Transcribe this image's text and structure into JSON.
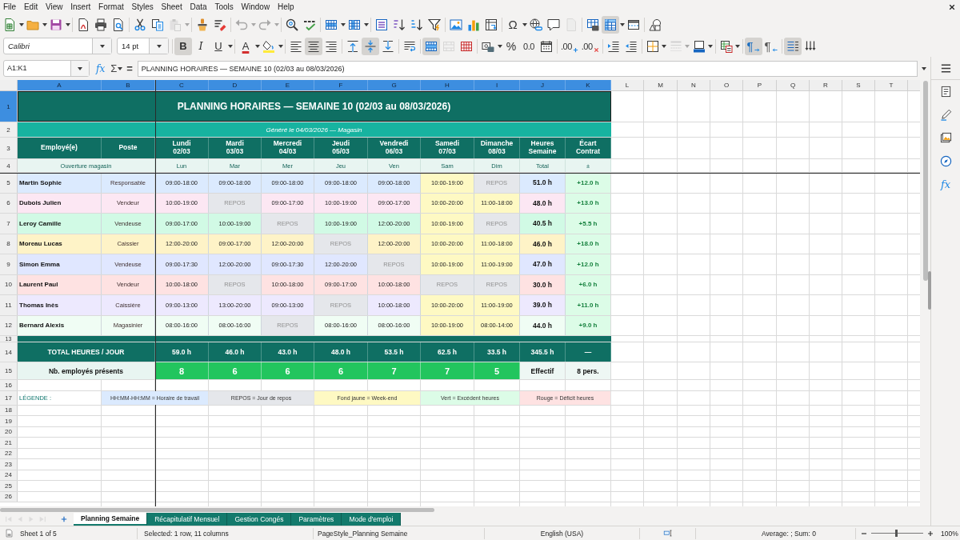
{
  "menu_bar": {
    "items": [
      "File",
      "Edit",
      "View",
      "Insert",
      "Format",
      "Styles",
      "Sheet",
      "Data",
      "Tools",
      "Window",
      "Help"
    ]
  },
  "standard_toolbar": {
    "paste": {
      "disabled": true
    },
    "undo": {
      "disabled": true
    },
    "redo": {
      "disabled": true
    },
    "special_character": {
      "label": "Ω"
    },
    "headers_footers": {
      "disabled": true
    },
    "freeze_panes": {
      "selected": true
    }
  },
  "formatting_toolbar": {
    "font_name": "Calibri",
    "font_size": "14 pt",
    "bold": {
      "label": "B",
      "selected": true
    },
    "italic": {
      "label": "I",
      "selected": false
    },
    "underline": {
      "label": "U",
      "selected": false
    },
    "font_color": {
      "label": "A"
    },
    "align_left": {
      "selected": false
    },
    "align_center": {
      "selected": true
    },
    "align_right": {
      "selected": false
    },
    "align_top": {
      "selected": false
    },
    "align_middle": {
      "selected": true
    },
    "align_bottom": {
      "selected": false
    },
    "wrap_text": {
      "selected": false
    },
    "merge_center": {
      "selected": true
    },
    "merge_cells": {
      "disabled": true
    },
    "percent": {
      "label": "%"
    },
    "number": {
      "label": "0.0"
    },
    "add_decimal": {
      "label": ".00"
    },
    "delete_decimal": {
      "label": ".00"
    },
    "border_style": {
      "disabled": true
    },
    "paragraph_ltr": {
      "label": "¶",
      "selected": true
    },
    "paragraph_rtl": {
      "label": "¶",
      "selected": false
    },
    "text_left_to_right": {
      "selected": true
    },
    "text_vertical": {
      "selected": false
    }
  },
  "formula_bar": {
    "name_box": "A1:K1",
    "function_wizard": "fx",
    "sum": "Σ",
    "formula": "=",
    "content": "PLANNING HORAIRES — SEMAINE 10 (02/03 au 08/03/2026)"
  },
  "sidebar": {
    "functions": "fx"
  },
  "sheet": {
    "columns": [
      {
        "label": "A",
        "selected": true
      },
      {
        "label": "B",
        "selected": true
      },
      {
        "label": "C",
        "selected": true
      },
      {
        "label": "D",
        "selected": true
      },
      {
        "label": "E",
        "selected": true
      },
      {
        "label": "F",
        "selected": true
      },
      {
        "label": "G",
        "selected": true
      },
      {
        "label": "H",
        "selected": true
      },
      {
        "label": "I",
        "selected": true
      },
      {
        "label": "J",
        "selected": true
      },
      {
        "label": "K",
        "selected": true
      },
      {
        "label": "L",
        "selected": false
      },
      {
        "label": "M",
        "selected": false
      },
      {
        "label": "N",
        "selected": false
      },
      {
        "label": "O",
        "selected": false
      },
      {
        "label": "P",
        "selected": false
      },
      {
        "label": "Q",
        "selected": false
      },
      {
        "label": "R",
        "selected": false
      },
      {
        "label": "S",
        "selected": false
      },
      {
        "label": "T",
        "selected": false
      }
    ],
    "rows": [
      {
        "number": "1",
        "selected": true,
        "kind": "title",
        "text": "PLANNING HORAIRES — SEMAINE 10 (02/03 au 08/03/2026)"
      },
      {
        "number": "2",
        "selected": false,
        "kind": "subtitle",
        "text": "Généré le 04/03/2026 — Magasin"
      },
      {
        "number": "3",
        "selected": false,
        "kind": "header",
        "cells": [
          "Employé(e)",
          "Poste",
          "Lundi\n02/03",
          "Mardi\n03/03",
          "Mercredi\n04/03",
          "Jeudi\n05/03",
          "Vendredi\n06/03",
          "Samedi\n07/03",
          "Dimanche\n08/03",
          "Heures\nSemaine",
          "Écart\nContrat"
        ]
      },
      {
        "number": "4",
        "selected": false,
        "kind": "subheader",
        "label": "Ouverture magasin",
        "cells": [
          "Lun",
          "Mar",
          "Mer",
          "Jeu",
          "Ven",
          "Sam",
          "Dim",
          "Total",
          "±"
        ]
      },
      {
        "number": "5",
        "selected": false,
        "kind": "employee",
        "color": "#dbeafe",
        "name": "Martin Sophie",
        "role": "Responsable",
        "shifts": [
          {
            "text": "09:00-18:00",
            "kind": "work"
          },
          {
            "text": "09:00-18:00",
            "kind": "work"
          },
          {
            "text": "09:00-18:00",
            "kind": "work"
          },
          {
            "text": "09:00-18:00",
            "kind": "work"
          },
          {
            "text": "09:00-18:00",
            "kind": "work"
          },
          {
            "text": "10:00-19:00",
            "kind": "weekend"
          },
          {
            "text": "REPOS",
            "kind": "rest"
          }
        ],
        "hours": "51.0 h",
        "balance": {
          "text": "+12.0 h",
          "kind": "excess"
        }
      },
      {
        "number": "6",
        "selected": false,
        "kind": "employee",
        "color": "#fce7f3",
        "name": "Dubois Julien",
        "role": "Vendeur",
        "shifts": [
          {
            "text": "10:00-19:00",
            "kind": "work"
          },
          {
            "text": "REPOS",
            "kind": "rest"
          },
          {
            "text": "09:00-17:00",
            "kind": "work"
          },
          {
            "text": "10:00-19:00",
            "kind": "work"
          },
          {
            "text": "09:00-17:00",
            "kind": "work"
          },
          {
            "text": "10:00-20:00",
            "kind": "weekend"
          },
          {
            "text": "11:00-18:00",
            "kind": "weekend"
          }
        ],
        "hours": "48.0 h",
        "balance": {
          "text": "+13.0 h",
          "kind": "excess"
        }
      },
      {
        "number": "7",
        "selected": false,
        "kind": "employee",
        "color": "#d1fae5",
        "name": "Leroy Camille",
        "role": "Vendeuse",
        "shifts": [
          {
            "text": "09:00-17:00",
            "kind": "work"
          },
          {
            "text": "10:00-19:00",
            "kind": "work"
          },
          {
            "text": "REPOS",
            "kind": "rest"
          },
          {
            "text": "10:00-19:00",
            "kind": "work"
          },
          {
            "text": "12:00-20:00",
            "kind": "work"
          },
          {
            "text": "10:00-19:00",
            "kind": "weekend"
          },
          {
            "text": "REPOS",
            "kind": "rest"
          }
        ],
        "hours": "40.5 h",
        "balance": {
          "text": "+5.5 h",
          "kind": "excess"
        }
      },
      {
        "number": "8",
        "selected": false,
        "kind": "employee",
        "color": "#fef3c7",
        "name": "Moreau Lucas",
        "role": "Caissier",
        "shifts": [
          {
            "text": "12:00-20:00",
            "kind": "work"
          },
          {
            "text": "09:00-17:00",
            "kind": "work"
          },
          {
            "text": "12:00-20:00",
            "kind": "work"
          },
          {
            "text": "REPOS",
            "kind": "rest"
          },
          {
            "text": "12:00-20:00",
            "kind": "work"
          },
          {
            "text": "10:00-20:00",
            "kind": "weekend"
          },
          {
            "text": "11:00-18:00",
            "kind": "weekend"
          }
        ],
        "hours": "46.0 h",
        "balance": {
          "text": "+18.0 h",
          "kind": "excess"
        }
      },
      {
        "number": "9",
        "selected": false,
        "kind": "employee",
        "color": "#e0e7ff",
        "name": "Simon Emma",
        "role": "Vendeuse",
        "shifts": [
          {
            "text": "09:00-17:30",
            "kind": "work"
          },
          {
            "text": "12:00-20:00",
            "kind": "work"
          },
          {
            "text": "09:00-17:30",
            "kind": "work"
          },
          {
            "text": "12:00-20:00",
            "kind": "work"
          },
          {
            "text": "REPOS",
            "kind": "rest"
          },
          {
            "text": "10:00-19:00",
            "kind": "weekend"
          },
          {
            "text": "11:00-19:00",
            "kind": "weekend"
          }
        ],
        "hours": "47.0 h",
        "balance": {
          "text": "+12.0 h",
          "kind": "excess"
        }
      },
      {
        "number": "10",
        "selected": false,
        "kind": "employee",
        "color": "#fee2e2",
        "name": "Laurent Paul",
        "role": "Vendeur",
        "shifts": [
          {
            "text": "10:00-18:00",
            "kind": "work"
          },
          {
            "text": "REPOS",
            "kind": "rest"
          },
          {
            "text": "10:00-18:00",
            "kind": "work"
          },
          {
            "text": "09:00-17:00",
            "kind": "work"
          },
          {
            "text": "10:00-18:00",
            "kind": "work"
          },
          {
            "text": "REPOS",
            "kind": "rest"
          },
          {
            "text": "REPOS",
            "kind": "rest"
          }
        ],
        "hours": "30.0 h",
        "balance": {
          "text": "+6.0 h",
          "kind": "excess"
        }
      },
      {
        "number": "11",
        "selected": false,
        "kind": "employee",
        "color": "#ede9fe",
        "name": "Thomas Inès",
        "role": "Caissière",
        "shifts": [
          {
            "text": "09:00-13:00",
            "kind": "work"
          },
          {
            "text": "13:00-20:00",
            "kind": "work"
          },
          {
            "text": "09:00-13:00",
            "kind": "work"
          },
          {
            "text": "REPOS",
            "kind": "rest"
          },
          {
            "text": "10:00-18:00",
            "kind": "work"
          },
          {
            "text": "10:00-20:00",
            "kind": "weekend"
          },
          {
            "text": "11:00-19:00",
            "kind": "weekend"
          }
        ],
        "hours": "39.0 h",
        "balance": {
          "text": "+11.0 h",
          "kind": "excess"
        }
      },
      {
        "number": "12",
        "selected": false,
        "kind": "employee",
        "color": "#f0fdf4",
        "name": "Bernard Alexis",
        "role": "Magasinier",
        "shifts": [
          {
            "text": "08:00-16:00",
            "kind": "work"
          },
          {
            "text": "08:00-16:00",
            "kind": "work"
          },
          {
            "text": "REPOS",
            "kind": "rest"
          },
          {
            "text": "08:00-16:00",
            "kind": "work"
          },
          {
            "text": "08:00-16:00",
            "kind": "work"
          },
          {
            "text": "10:00-19:00",
            "kind": "weekend"
          },
          {
            "text": "08:00-14:00",
            "kind": "weekend"
          }
        ],
        "hours": "44.0 h",
        "balance": {
          "text": "+9.0 h",
          "kind": "excess"
        }
      },
      {
        "number": "13",
        "selected": false,
        "kind": "separator"
      },
      {
        "number": "14",
        "selected": false,
        "kind": "total",
        "label": "TOTAL HEURES / JOUR",
        "values": [
          "59.0 h",
          "46.0 h",
          "43.0 h",
          "48.0 h",
          "53.5 h",
          "62.5 h",
          "33.5 h"
        ],
        "total": "345.5 h",
        "balance": "—"
      },
      {
        "number": "15",
        "selected": false,
        "kind": "count",
        "label": "Nb. employés présents",
        "counts": [
          "8",
          "6",
          "6",
          "6",
          "7",
          "7",
          "5"
        ],
        "summary": [
          "Effectif",
          "8 pers."
        ]
      },
      {
        "number": "16",
        "selected": false,
        "kind": "blank"
      },
      {
        "number": "17",
        "selected": false,
        "kind": "legend",
        "title": "LÉGENDE :",
        "items": [
          {
            "text": "HH:MM-HH:MM = Horaire de travail",
            "color": "#dbeafe"
          },
          {
            "text": "REPOS = Jour de repos",
            "color": "#e5e7eb"
          },
          {
            "text": "Fond jaune = Week-end",
            "color": "#fef9c3"
          },
          {
            "text": "Vert = Excédent heures",
            "color": "#dcfce7"
          },
          {
            "text": "Rouge = Déficit heures",
            "color": "#fee2e2"
          }
        ]
      },
      {
        "number": "18",
        "selected": false,
        "kind": "blank"
      },
      {
        "number": "19",
        "selected": false,
        "kind": "blank"
      },
      {
        "number": "20",
        "selected": false,
        "kind": "blank"
      },
      {
        "number": "21",
        "selected": false,
        "kind": "blank"
      },
      {
        "number": "22",
        "selected": false,
        "kind": "blank"
      },
      {
        "number": "23",
        "selected": false,
        "kind": "blank"
      },
      {
        "number": "24",
        "selected": false,
        "kind": "blank"
      },
      {
        "number": "25",
        "selected": false,
        "kind": "blank"
      },
      {
        "number": "26",
        "selected": false,
        "kind": "blank"
      }
    ]
  },
  "sheet_tab_bar": {
    "navigation": {
      "disabled": true
    },
    "tabs": [
      {
        "label": "Planning Semaine",
        "selected": true
      },
      {
        "label": "Récapitulatif Mensuel",
        "selected": false
      },
      {
        "label": "Gestion Congés",
        "selected": false
      },
      {
        "label": "Paramètres",
        "selected": false
      },
      {
        "label": "Mode d'emploi",
        "selected": false
      }
    ]
  },
  "status_bar": {
    "sheet_position": "Sheet 1 of 5",
    "selection": "Selected: 1 row, 11 columns",
    "page_style": "PageStyle_Planning Semaine",
    "language": "English (USA)",
    "summary": "Average: ; Sum: 0",
    "zoom": {
      "level": 0.48,
      "reading": "100%"
    }
  }
}
